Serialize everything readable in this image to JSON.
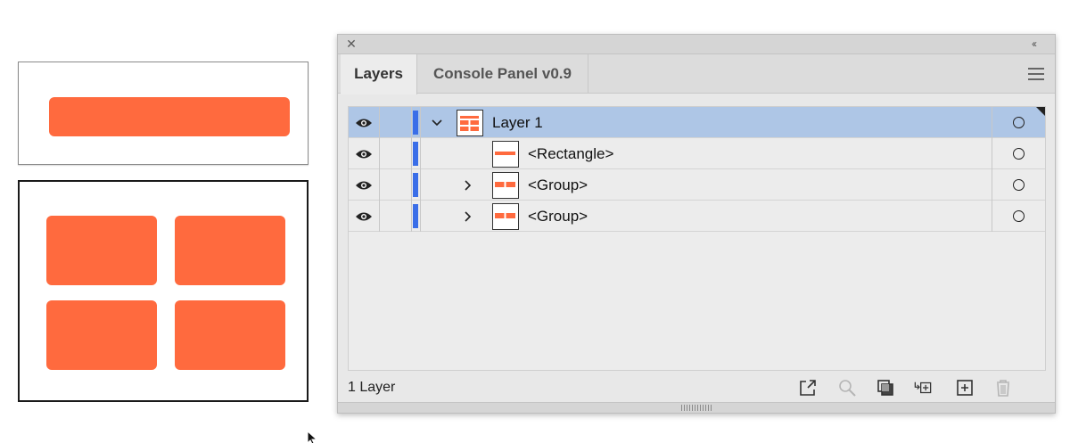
{
  "panel": {
    "tabs": [
      {
        "label": "Layers",
        "active": true
      },
      {
        "label": "Console Panel v0.9",
        "active": false
      }
    ],
    "close_icon": "close-icon",
    "collapse_icon": "double-chevron-icon",
    "menu_icon": "hamburger-menu-icon"
  },
  "layers": [
    {
      "label": "Layer 1",
      "expanded": true,
      "selected": true,
      "thumbnail": "layer-thumb"
    },
    {
      "label": "<Rectangle>",
      "expanded": false,
      "selected": false,
      "thumbnail": "rectangle-thumb"
    },
    {
      "label": "<Group>",
      "expanded": false,
      "selected": false,
      "thumbnail": "group-thumb"
    },
    {
      "label": "<Group>",
      "expanded": false,
      "selected": false,
      "thumbnail": "group-thumb"
    }
  ],
  "footer": {
    "count_label": "1 Layer",
    "icons": [
      "export-icon",
      "locate-object-icon",
      "make-clipping-mask-icon",
      "create-sublayer-icon",
      "new-layer-icon",
      "trash-icon"
    ]
  },
  "colors": {
    "accent_orange": "#ff6a3e",
    "layer_color_bar": "#3a6ee8",
    "selection_bg": "#aec6e6"
  }
}
